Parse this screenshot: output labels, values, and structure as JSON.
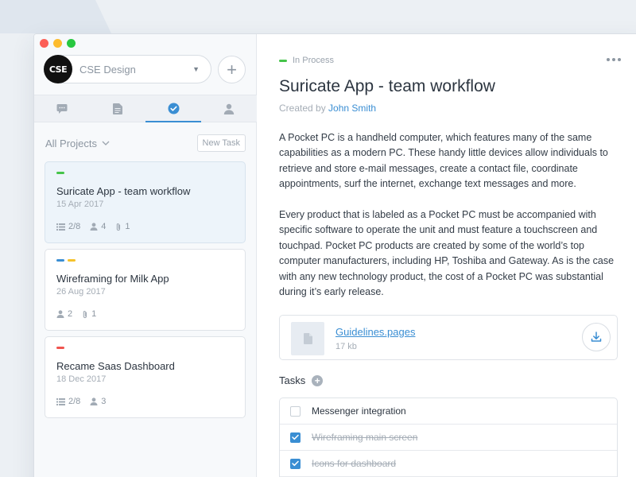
{
  "window": {
    "traffic_lights": [
      "close",
      "minimize",
      "zoom"
    ]
  },
  "sidebar": {
    "org": {
      "logo_text": "CSE",
      "name": "CSE Design"
    },
    "tabs": [
      {
        "name": "chat-bubble-icon",
        "active": false
      },
      {
        "name": "document-icon",
        "active": false
      },
      {
        "name": "checkmark-circle-icon",
        "active": true
      },
      {
        "name": "user-icon",
        "active": false
      }
    ],
    "filter_label": "All Projects",
    "new_task_label": "New Task",
    "projects": [
      {
        "title": "Suricate App - team workflow",
        "date": "15 Apr 2017",
        "tags": [
          "#45c44a"
        ],
        "tasks": "2/8",
        "members": "4",
        "attachments": "1"
      },
      {
        "title": "Wireframing for Milk App",
        "date": "26 Aug 2017",
        "tags": [
          "#3a8ed3",
          "#f5c22b"
        ],
        "members": "2",
        "attachments": "1"
      },
      {
        "title": "Recame Saas Dashboard",
        "date": "18 Dec 2017",
        "tags": [
          "#f0544f"
        ],
        "tasks": "2/8",
        "members": "3"
      }
    ]
  },
  "detail": {
    "status": "In Process",
    "status_color": "#45c44a",
    "title": "Suricate App - team workflow",
    "created_prefix": "Created by",
    "created_by": "John Smith",
    "paragraphs": [
      "A Pocket PC is a handheld computer, which features many of the same capabilities as a modern PC. These handy little devices allow individuals to retrieve and store e-mail messages, create a contact file, coordinate appointments, surf the internet, exchange text messages and more.",
      "Every product that is labeled as a Pocket PC must be accompanied with specific software to operate the unit and must feature a touchscreen and touchpad. Pocket PC products are created by some of the world’s top computer manufacturers, including HP, Toshiba and Gateway. As is the case with any new technology product, the cost of a Pocket PC was substantial during it’s early release."
    ],
    "attachment": {
      "name": "Guidelines.pages",
      "size": "17 kb"
    },
    "tasks_label": "Tasks",
    "tasks": [
      {
        "text": "Messenger integration",
        "done": false
      },
      {
        "text": "Wireframing main screen",
        "done": true
      },
      {
        "text": "Icons for dashboard",
        "done": true
      }
    ]
  },
  "colors": {
    "accent": "#3a8ed3",
    "background": "#ecf0f4"
  }
}
